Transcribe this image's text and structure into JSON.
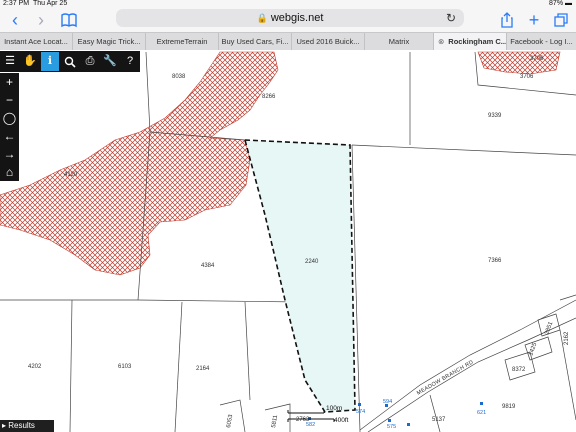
{
  "status": {
    "time": "2:37 PM",
    "date": "Thu Apr 25",
    "battery": "87%"
  },
  "browser": {
    "url": "webgis.net",
    "tabs": [
      {
        "label": "Instant Ace Locat..."
      },
      {
        "label": "Easy Magic Trick..."
      },
      {
        "label": "ExtremeTerrain"
      },
      {
        "label": "Buy Used Cars, Fi..."
      },
      {
        "label": "Used 2016 Buick..."
      },
      {
        "label": "Matrix"
      },
      {
        "label": "Rockingham C..."
      },
      {
        "label": "Facebook - Log I..."
      }
    ]
  },
  "map": {
    "parcel_labels": {
      "p8038": "8038",
      "p8266": "8266",
      "p3706": "3706",
      "p3706b": "3706",
      "p9339": "9339",
      "p4120": "4120",
      "p4384": "4384",
      "p2240": "2240",
      "p7366": "7366",
      "p4202": "4202",
      "p6103": "6103",
      "p2164": "2164",
      "p8372": "8372",
      "p9819": "9819",
      "p5137": "5137",
      "p2162": "2162",
      "p1425": "1425",
      "p2851": "2851",
      "p6053": "6053",
      "p2763": "2763",
      "p5811": "5811"
    },
    "address_labels": {
      "a574": "574",
      "a594": "594",
      "a575": "575",
      "a621": "621",
      "a582": "582"
    },
    "road_label": "MEADOW BRANCH RD",
    "scale": {
      "metric": "100m",
      "imperial": "400ft"
    }
  },
  "tools": {
    "top": [
      "menu-icon",
      "hand-icon",
      "info-icon",
      "search-icon",
      "print-icon",
      "wrench-icon",
      "help-icon"
    ],
    "side": [
      "zoom-in-icon",
      "zoom-out-icon",
      "full-extent-icon",
      "back-icon",
      "forward-icon",
      "home-icon"
    ]
  },
  "results_label": "Results",
  "colors": {
    "hatch": "#c0392b",
    "selection_fill": "#e6f7f6",
    "tool_active": "#2a9ce0"
  }
}
